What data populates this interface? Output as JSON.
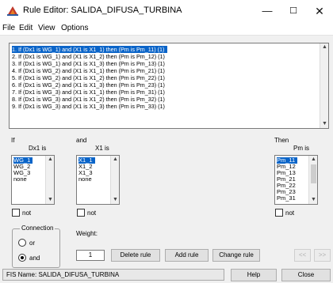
{
  "window": {
    "title": "Rule Editor: SALIDA_DIFUSA_TURBINA",
    "minimize": "—",
    "maximize": "☐",
    "close": "✕"
  },
  "menu": [
    "File",
    "Edit",
    "View",
    "Options"
  ],
  "rules": [
    "1. If (Dx1 is WG_1) and (X1 is X1_1) then (Pm is Pm_11) (1)",
    "2. If (Dx1 is WG_1) and (X1 is X1_2) then (Pm is Pm_12) (1)",
    "3. If (Dx1 is WG_1) and (X1 is X1_3) then (Pm is Pm_13) (1)",
    "4. If (Dx1 is WG_2) and (X1 is X1_1) then (Pm is Pm_21) (1)",
    "5. If (Dx1 is WG_2) and (X1 is X1_2) then (Pm is Pm_22) (1)",
    "6. If (Dx1 is WG_2) and (X1 is X1_3) then (Pm is Pm_23) (1)",
    "7. If (Dx1 is WG_3) and (X1 is X1_1) then (Pm is Pm_31) (1)",
    "8. If (Dx1 is WG_3) and (X1 is X1_2) then (Pm is Pm_32) (1)",
    "9. If (Dx1 is WG_3) and (X1 is X1_3) then (Pm is Pm_33) (1)"
  ],
  "selected_rule_index": 0,
  "antecedent1": {
    "prefix": "If",
    "label": "Dx1 is",
    "items": [
      "WG_1",
      "WG_2",
      "WG_3",
      "none"
    ],
    "selected": 0,
    "not_label": "not"
  },
  "antecedent2": {
    "prefix": "and",
    "label": "X1 is",
    "items": [
      "X1_1",
      "X1_2",
      "X1_3",
      "none"
    ],
    "selected": 0,
    "not_label": "not"
  },
  "consequent": {
    "prefix": "Then",
    "label": "Pm is",
    "items": [
      "Pm_11",
      "Pm_12",
      "Pm_13",
      "Pm_21",
      "Pm_22",
      "Pm_23",
      "Pm_31"
    ],
    "selected": 0,
    "not_label": "not"
  },
  "connection": {
    "title": "Connection",
    "options": [
      "or",
      "and"
    ],
    "selected": "and"
  },
  "weight": {
    "label": "Weight:",
    "value": "1"
  },
  "buttons": {
    "delete": "Delete rule",
    "add": "Add rule",
    "change": "Change rule",
    "prev": "<<",
    "next": ">>",
    "help": "Help",
    "close": "Close"
  },
  "status": "FIS Name: SALIDA_DIFUSA_TURBINA",
  "colors": {
    "selection": "#0a64c8",
    "background": "#f0f0f0"
  },
  "icons": {
    "app": "matlab-fuzzy-icon",
    "scroll_up": "▲",
    "scroll_down": "▼"
  }
}
